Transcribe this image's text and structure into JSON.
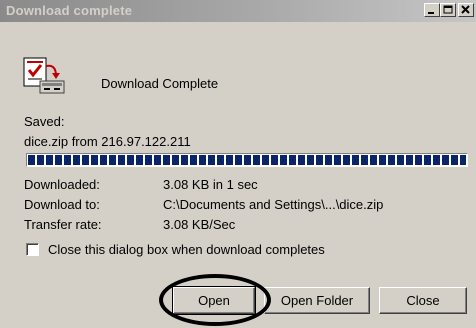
{
  "window": {
    "title": "Download complete",
    "title_buttons": {
      "minimize": "minimize",
      "maximize": "maximize",
      "close": "close"
    }
  },
  "header": {
    "icon": "download-complete-icon",
    "text": "Download Complete"
  },
  "saved": {
    "label": "Saved:",
    "file": "dice.zip from 216.97.122.211"
  },
  "progress": {
    "percent": 100
  },
  "info": {
    "downloaded_label": "Downloaded:",
    "downloaded_value": "3.08 KB in 1 sec",
    "download_to_label": "Download to:",
    "download_to_value": "C:\\Documents and Settings\\...\\dice.zip",
    "transfer_rate_label": "Transfer rate:",
    "transfer_rate_value": "3.08 KB/Sec"
  },
  "options": {
    "close_on_complete_label": "Close this dialog box when download completes",
    "close_on_complete_checked": false
  },
  "buttons": {
    "open": "Open",
    "open_folder": "Open Folder",
    "close": "Close"
  }
}
